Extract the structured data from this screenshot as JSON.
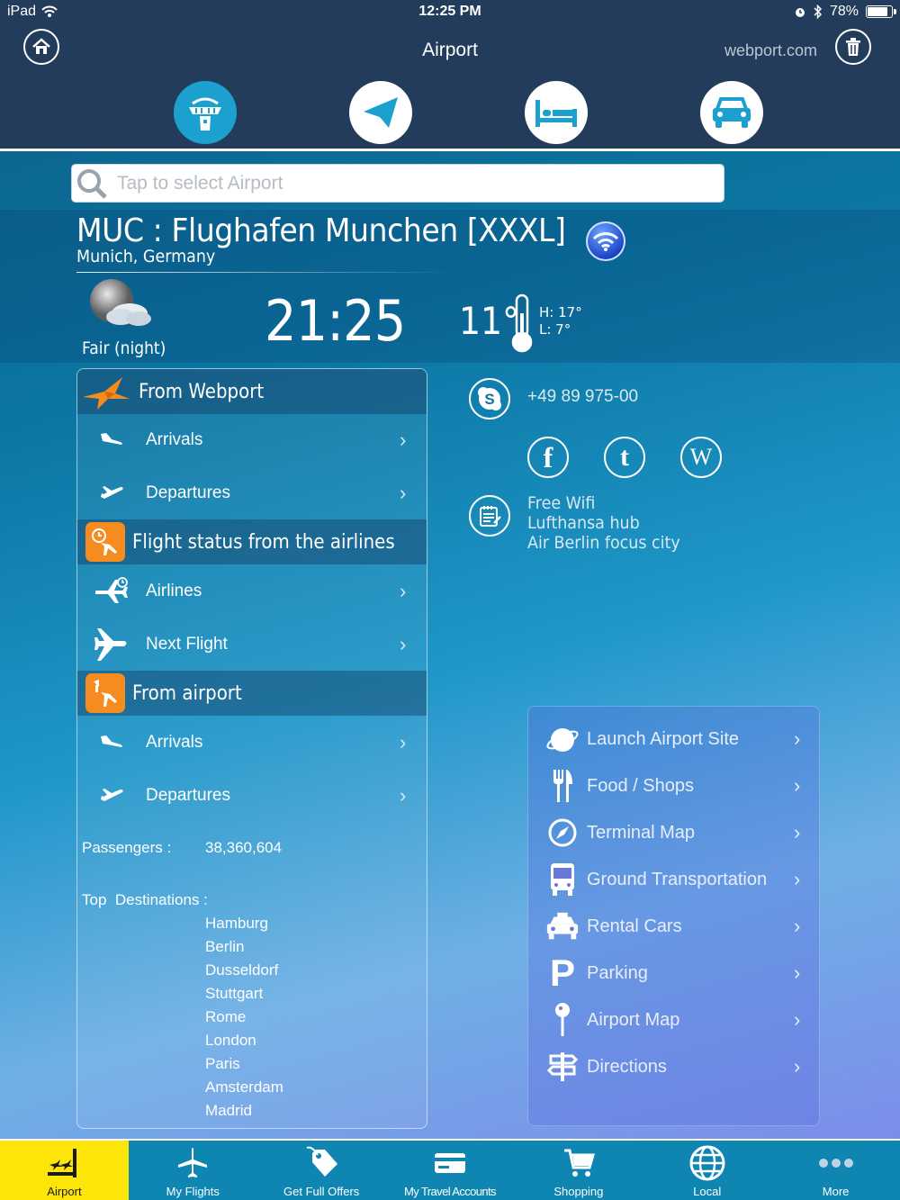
{
  "status_bar": {
    "device": "iPad",
    "time": "12:25 PM",
    "battery": "78%"
  },
  "nav": {
    "title": "Airport",
    "site_link": "webport.com"
  },
  "search": {
    "placeholder": "Tap to select Airport"
  },
  "airport": {
    "title": "MUC : Flughafen Munchen [XXXL]",
    "city": "Munich, Germany",
    "weather": "Fair (night)",
    "local_time": "21:25",
    "temperature": "11°",
    "high": "H: 17°",
    "low": "L: 7°"
  },
  "left_panel": {
    "sections": [
      {
        "title": "From Webport",
        "items": [
          {
            "label": "Arrivals"
          },
          {
            "label": "Departures"
          }
        ]
      },
      {
        "title": "Flight status from the airlines",
        "items": [
          {
            "label": "Airlines"
          },
          {
            "label": "Next Flight"
          }
        ]
      },
      {
        "title": "From airport",
        "items": [
          {
            "label": "Arrivals"
          },
          {
            "label": "Departures"
          }
        ]
      }
    ],
    "passengers_label": "Passengers :",
    "passengers_value": "38,360,604",
    "top_destinations_label": "Top  Destinations :",
    "destinations": [
      "Hamburg",
      "Berlin",
      "Dusseldorf",
      "Stuttgart",
      "Rome",
      "London",
      "Paris",
      "Amsterdam",
      "Madrid"
    ]
  },
  "contact": {
    "phone": "+49 89 975-00",
    "info_lines": [
      "Free Wifi",
      "Lufthansa hub",
      "Air Berlin focus city"
    ]
  },
  "services": [
    {
      "label": "Launch Airport Site",
      "icon": "globe-icon"
    },
    {
      "label": "Food / Shops",
      "icon": "fork-knife-icon"
    },
    {
      "label": "Terminal Map",
      "icon": "compass-icon"
    },
    {
      "label": "Ground Transportation",
      "icon": "bus-icon"
    },
    {
      "label": "Rental Cars",
      "icon": "taxi-icon"
    },
    {
      "label": "Parking",
      "icon": "parking-icon"
    },
    {
      "label": "Airport Map",
      "icon": "pin-icon"
    },
    {
      "label": "Directions",
      "icon": "signpost-icon"
    }
  ],
  "tabs": [
    {
      "label": "Airport"
    },
    {
      "label": "My Flights"
    },
    {
      "label": "Get Full Offers"
    },
    {
      "label": "My Travel Accounts"
    },
    {
      "label": "Shopping"
    },
    {
      "label": "Local"
    },
    {
      "label": "More"
    }
  ],
  "colors": {
    "nav_bg": "#233c5b",
    "accent": "#1ca0cf",
    "orange": "#f68c1f",
    "active_tab": "#fde50a",
    "tab_bg": "#0f86b1"
  }
}
